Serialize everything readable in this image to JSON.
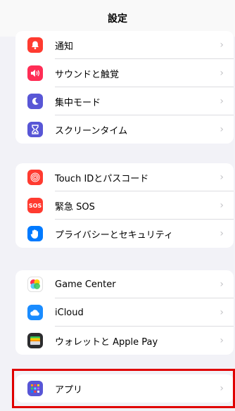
{
  "header": {
    "title": "設定"
  },
  "groups": [
    {
      "items": [
        {
          "label": "通知",
          "icon": "bell-icon",
          "color": "#ff3b30"
        },
        {
          "label": "サウンドと触覚",
          "icon": "speaker-icon",
          "color": "#ff2d55"
        },
        {
          "label": "集中モード",
          "icon": "moon-icon",
          "color": "#5856d6"
        },
        {
          "label": "スクリーンタイム",
          "icon": "hourglass-icon",
          "color": "#5856d6"
        }
      ]
    },
    {
      "items": [
        {
          "label": "Touch IDとパスコード",
          "icon": "fingerprint-icon",
          "color": "#ff3b30"
        },
        {
          "label": "緊急 SOS",
          "icon": "sos-icon",
          "color": "#ff3b30",
          "icon_text": "SOS"
        },
        {
          "label": "プライバシーとセキュリティ",
          "icon": "hand-icon",
          "color": "#007aff"
        }
      ]
    },
    {
      "items": [
        {
          "label": "Game Center",
          "icon": "game-center-icon",
          "color": "#ffffff"
        },
        {
          "label": "iCloud",
          "icon": "cloud-icon",
          "color": "#1a8cff"
        },
        {
          "label": "ウォレットと Apple Pay",
          "icon": "wallet-icon",
          "color": "#2c2c2e"
        }
      ]
    },
    {
      "items": [
        {
          "label": "アプリ",
          "icon": "apps-grid-icon",
          "color": "#5856d6"
        }
      ]
    }
  ],
  "chevron": "›",
  "highlight_color": "#e00000"
}
